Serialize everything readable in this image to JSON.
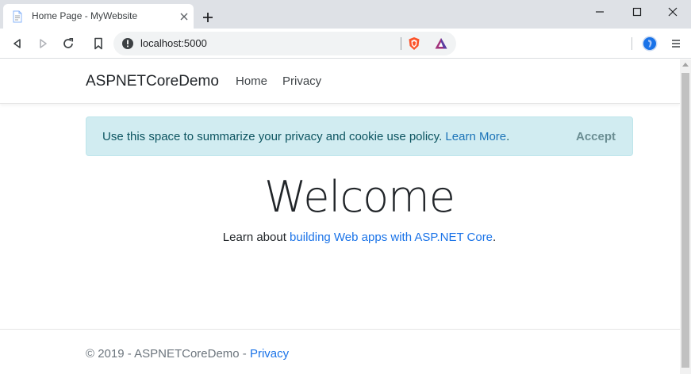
{
  "browser": {
    "tab_title": "Home Page - MyWebsite",
    "url": "localhost:5000",
    "icons": [
      "page-favicon-icon",
      "close-icon",
      "plus-icon",
      "minimize-icon",
      "maximize-icon",
      "window-close-icon",
      "back-icon",
      "forward-icon",
      "reload-icon",
      "bookmark-icon",
      "info-icon",
      "brave-shield-icon",
      "brave-rewards-icon",
      "profile-icon",
      "menu-icon"
    ]
  },
  "navbar": {
    "brand": "ASPNETCoreDemo",
    "links": [
      "Home",
      "Privacy"
    ]
  },
  "cookie_alert": {
    "text": "Use this space to summarize your privacy and cookie use policy.",
    "link": "Learn More",
    "period": ".",
    "accept": "Accept"
  },
  "main": {
    "heading": "Welcome",
    "learn_prefix": "Learn about",
    "learn_link": "building Web apps with ASP.NET Core",
    "learn_suffix": "."
  },
  "footer": {
    "copyright": "© 2019 - ASPNETCoreDemo -",
    "link": "Privacy"
  },
  "colors": {
    "alert_bg": "#d1ecf1",
    "alert_text": "#0c5460",
    "link": "#1a73e8",
    "tabbar_bg": "#dee1e6"
  }
}
